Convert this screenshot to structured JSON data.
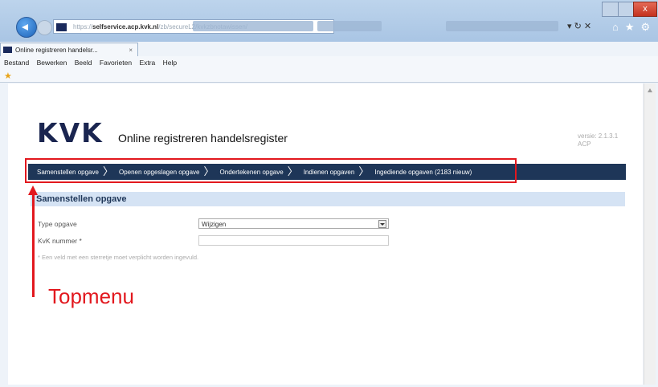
{
  "browser": {
    "url_prefix": "https://",
    "url_host": "selfservice.acp.kvk.nl",
    "url_path": "/zb/secureL2/kvkzbnotawissen/",
    "tab_title": "Online registreren handelsr...",
    "tab_close": "×",
    "close_glyph": "x",
    "address_tools": "▾ ↻ ✕",
    "nav_icons": "⌂★⚙",
    "menu": [
      "Bestand",
      "Bewerken",
      "Beeld",
      "Favorieten",
      "Extra",
      "Help"
    ]
  },
  "page": {
    "logo": "KVK",
    "title": "Online registreren handelsregister",
    "version_line1": "versie: 2.1.3.1",
    "version_line2": "ACP",
    "topmenu": [
      {
        "label": "Samenstellen opgave"
      },
      {
        "label": "Openen opgeslagen opgave"
      },
      {
        "label": "Ondertekenen opgave"
      },
      {
        "label": "Indienen opgaven"
      },
      {
        "label": "Ingediende opgaven (2183 nieuw)"
      }
    ],
    "topmenu_separator": "〉",
    "section_title": "Samenstellen opgave",
    "form": {
      "type_label": "Type opgave",
      "type_value": "Wijzigen",
      "kvk_label": "KvK nummer *",
      "kvk_value": "",
      "required_note": "* Een veld met een sterretje moet verplicht worden ingevuld."
    }
  },
  "annotation": {
    "label": "Topmenu",
    "color": "#e2181e"
  },
  "colors": {
    "menu_bg": "#1e3658",
    "section_bg": "#d5e3f4",
    "logo": "#1a2550"
  }
}
